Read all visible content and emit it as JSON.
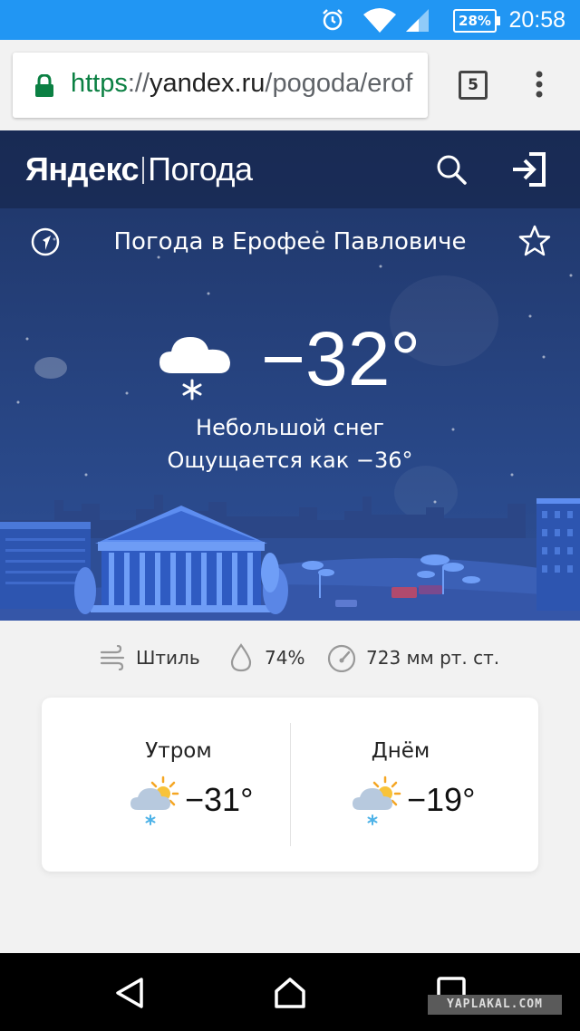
{
  "status_bar": {
    "battery": "28%",
    "time": "20:58",
    "accent": "#2196f3"
  },
  "browser": {
    "url_protocol": "https",
    "url_sep": "://",
    "url_host": "yandex.ru",
    "url_path": "/pogoda/erof",
    "tab_count": "5"
  },
  "header": {
    "logo_yandex": "Яндекс",
    "logo_product": "Погода"
  },
  "location": {
    "title": "Погода в Ерофее Павловиче"
  },
  "current": {
    "temperature": "−32°",
    "condition": "Небольшой снег",
    "feels_like": "Ощущается как −36°",
    "icon": "cloud-snow-icon"
  },
  "metrics": {
    "wind": "Штиль",
    "humidity": "74%",
    "pressure": "723 мм рт. ст."
  },
  "forecast": [
    {
      "label": "Утром",
      "temp": "−31°",
      "icon": "partly-cloudy-snow-icon"
    },
    {
      "label": "Днём",
      "temp": "−19°",
      "icon": "partly-cloudy-snow-icon"
    }
  ],
  "watermark": "YAPLAKAL.COM"
}
